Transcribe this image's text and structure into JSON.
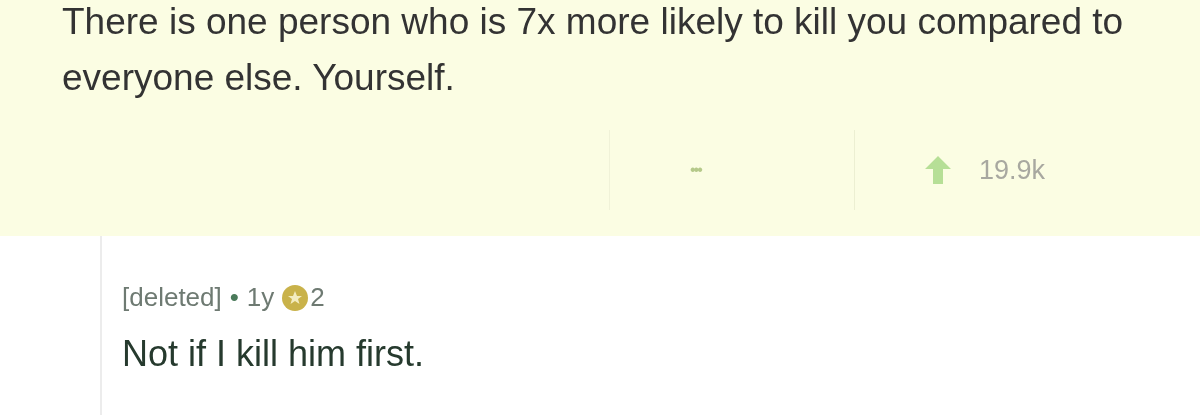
{
  "post": {
    "body": "There is one person who is 7x more likely to kill you compared to everyone else. Yourself.",
    "more": "•••",
    "score": "19.9k"
  },
  "reply": {
    "author": "[deleted]",
    "separator": "•",
    "age": "1y",
    "awards": "2",
    "body": "Not if I kill him first."
  }
}
